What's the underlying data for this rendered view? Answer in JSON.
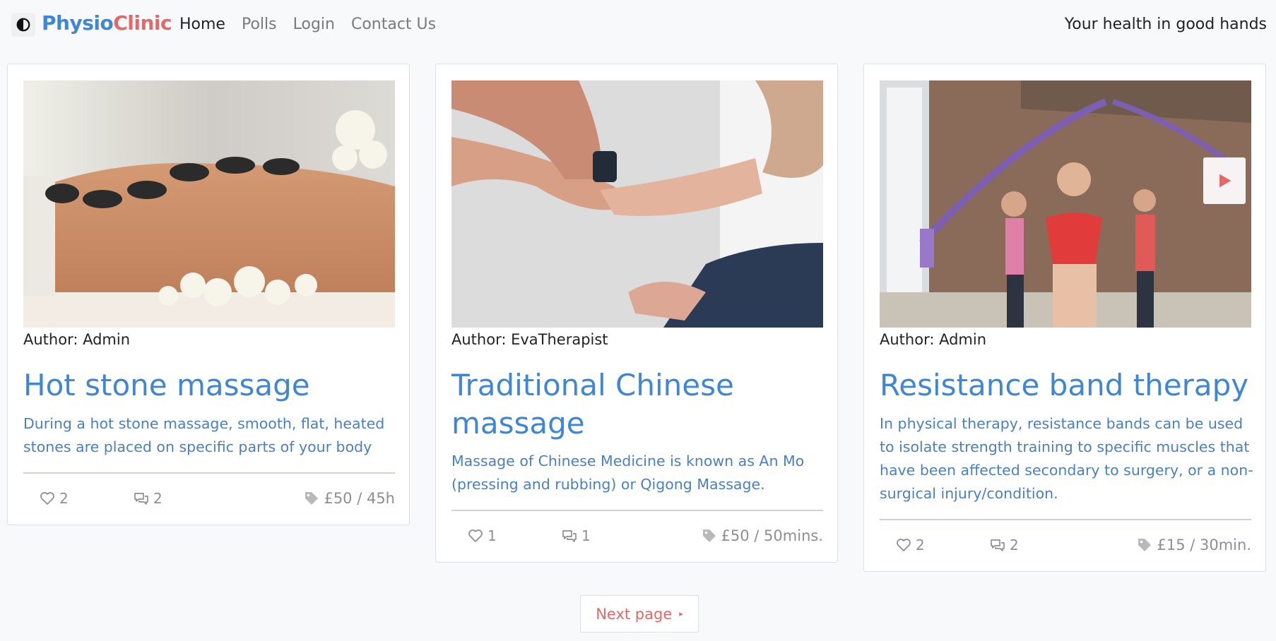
{
  "navbar": {
    "brand_part1": "Physio",
    "brand_part2": "Clinic",
    "links": [
      "Home",
      "Polls",
      "Login",
      "Contact Us"
    ],
    "active": "Home",
    "tagline": "Your health in good hands"
  },
  "cards": [
    {
      "author": "Author: Admin",
      "title": "Hot stone massage",
      "description": "During a hot stone massage, smooth, flat, heated stones are placed on specific parts of your body",
      "likes": "2",
      "comments": "2",
      "price": "£50 / 45h"
    },
    {
      "author": "Author: EvaTherapist",
      "title": "Traditional Chinese massage",
      "description": "Massage of Chinese Medicine is known as An Mo (pressing and rubbing) or Qigong Massage.",
      "likes": "1",
      "comments": "1",
      "price": "£50 / 50mins."
    },
    {
      "author": "Author: Admin",
      "title": "Resistance band therapy",
      "description": "In physical therapy, resistance bands can be used to isolate strength training to specific muscles that have been affected secondary to surgery, or a non-surgical injury/condition.",
      "likes": "2",
      "comments": "2",
      "price": "£15 / 30min."
    }
  ],
  "pagination": {
    "next_label": "Next page",
    "next_arrow": "▸"
  },
  "colors": {
    "brand_blue": "#3f86d4",
    "brand_red": "#e0696c",
    "meta_gray": "#8f8f8f"
  },
  "icons": [
    "theme-toggle-icon",
    "heart-icon",
    "comments-icon",
    "price-tag-icon",
    "play-icon"
  ]
}
